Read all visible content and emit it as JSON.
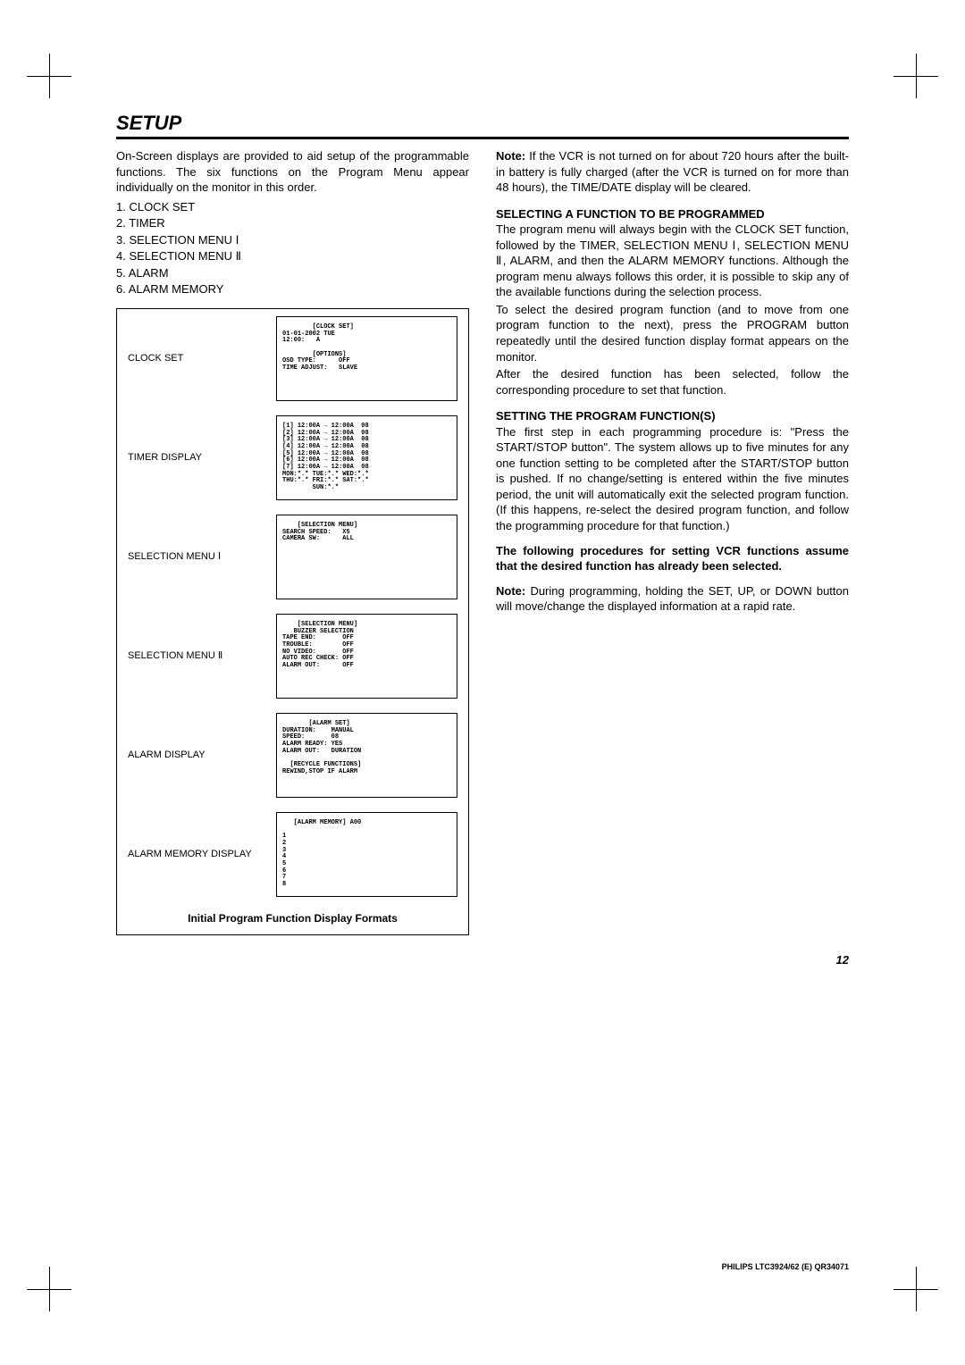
{
  "title": "SETUP",
  "left": {
    "intro": "On-Screen displays are provided to aid setup of the programmable functions.  The six functions on the Program Menu appear individually on the monitor in this order.",
    "menu": [
      "1.  CLOCK SET",
      "2.  TIMER",
      "3.  SELECTION MENU  Ⅰ",
      "4.  SELECTION MENU  Ⅱ",
      "5.  ALARM",
      "6.  ALARM MEMORY"
    ],
    "rows": [
      {
        "label": "CLOCK SET",
        "text": "        [CLOCK SET]\n01-01-2002 TUE\n12:00:   A\n\n        [OPTIONS]\nOSD TYPE:      OFF\nTIME ADJUST:   SLAVE"
      },
      {
        "label": "TIMER DISPLAY",
        "text": "[1] 12:00A → 12:00A  08\n[2] 12:00A → 12:00A  08\n[3] 12:00A → 12:00A  08\n[4] 12:00A → 12:00A  08\n[5] 12:00A → 12:00A  08\n[6] 12:00A → 12:00A  08\n[7] 12:00A → 12:00A  08\nMON:*.* TUE:*.* WED:*.*\nTHU:*.* FRI:*.* SAT:*.*\n        SUN:*.*"
      },
      {
        "label": "SELECTION MENU  Ⅰ",
        "text": "    [SELECTION MENU]\nSEARCH SPEED:   X5\nCAMERA SW:      ALL"
      },
      {
        "label": "SELECTION MENU  Ⅱ",
        "text": "    [SELECTION MENU]\n   BUZZER SELECTION\nTAPE END:       OFF\nTROUBLE:        OFF\nNO VIDEO:       OFF\nAUTO REC CHECK: OFF\nALARM OUT:      OFF"
      },
      {
        "label": "ALARM DISPLAY",
        "text": "       [ALARM SET]\nDURATION:    MANUAL\nSPEED:       08\nALARM READY: YES\nALARM OUT:   DURATION\n\n  [RECYCLE FUNCTIONS]\nREWIND,STOP IF ALARM"
      },
      {
        "label": "ALARM MEMORY DISPLAY",
        "text": "   [ALARM MEMORY] A00\n\n1\n2\n3\n4\n5\n6\n7\n8"
      }
    ],
    "caption": "Initial Program Function Display Formats"
  },
  "right": {
    "note1_label": "Note:",
    "note1_text": "  If the VCR is not turned on for about 720 hours after the built-in battery is fully charged (after the VCR is turned on for more than 48 hours), the TIME/DATE display will be cleared.",
    "h1": "SELECTING A FUNCTION TO BE PROGRAMMED",
    "p1": "The program menu will always begin with the CLOCK SET function, followed by the TIMER, SELECTION MENU Ⅰ, SELECTION MENU Ⅱ, ALARM, and then the ALARM MEMORY functions.  Although the program menu always follows this order, it is possible to skip any of the available functions during the selection process.",
    "p2": "To select the desired program function (and to move from one program function to the next), press the PROGRAM button repeatedly until the desired function display format appears on the monitor.",
    "p3": "After the desired function has been selected, follow the corresponding procedure to set that function.",
    "h2": "SETTING THE PROGRAM FUNCTION(S)",
    "p4": "The first step in each programming procedure is: \"Press the START/STOP button\".  The system allows up to five minutes for any one function setting to be completed after the START/STOP button is pushed.  If no change/setting is entered within the five minutes period, the unit will automatically exit the selected program function.  (If this happens, re-select the desired program function, and follow the programming procedure for that function.)",
    "bold_para": "The following procedures for setting VCR functions assume that the desired function has already been selected.",
    "note2_label": "Note:",
    "note2_text": "  During programming, holding the SET, UP, or DOWN button will move/change the displayed information at a rapid rate."
  },
  "pageNumber": "12",
  "footerCode": "PHILIPS LTC3924/62 (E) QR34071"
}
